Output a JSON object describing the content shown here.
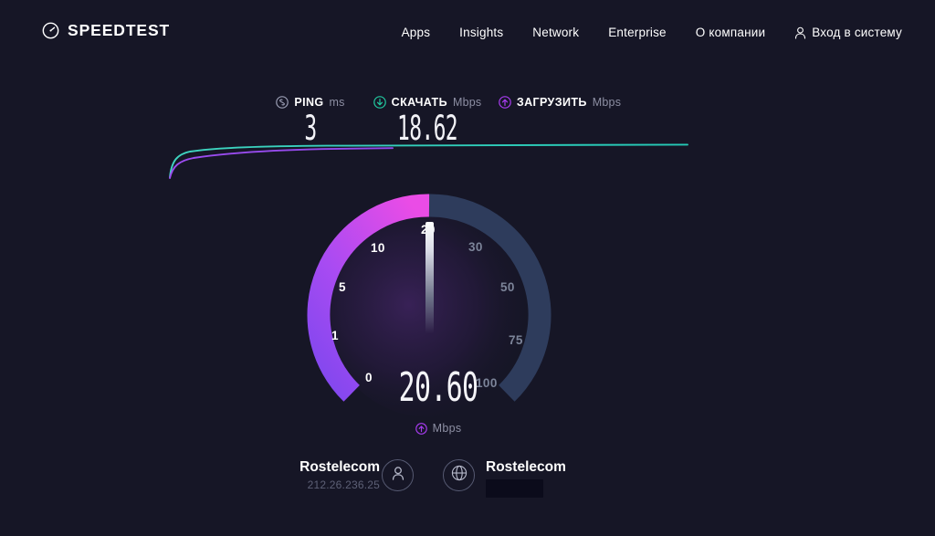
{
  "header": {
    "logo_text": "SPEEDTEST",
    "logo_icon": "speedometer-icon",
    "nav": [
      {
        "label": "Apps"
      },
      {
        "label": "Insights"
      },
      {
        "label": "Network"
      },
      {
        "label": "Enterprise"
      },
      {
        "label": "О компании"
      }
    ],
    "login": {
      "label": "Вход в систему",
      "icon": "person-icon"
    }
  },
  "metrics": {
    "ping": {
      "label": "PING",
      "unit": "ms",
      "value": "3",
      "icon": "ping-icon",
      "color": "#9a9db3"
    },
    "download": {
      "label": "СКАЧАТЬ",
      "unit": "Mbps",
      "value": "18.62",
      "icon": "download-icon",
      "color": "#22c9a0"
    },
    "upload": {
      "label": "ЗАГРУЗИТЬ",
      "unit": "Mbps",
      "value": "",
      "icon": "upload-icon",
      "color": "#a83cf0"
    }
  },
  "gauge": {
    "value": "20.60",
    "unit": "Mbps",
    "unit_icon": "upload-icon",
    "phase": "upload",
    "ticks": [
      {
        "label": "0",
        "active": true
      },
      {
        "label": "1",
        "active": true
      },
      {
        "label": "5",
        "active": true
      },
      {
        "label": "10",
        "active": true
      },
      {
        "label": "20",
        "active": true
      },
      {
        "label": "30",
        "active": false
      },
      {
        "label": "50",
        "active": false
      },
      {
        "label": "75",
        "active": false
      },
      {
        "label": "100",
        "active": false
      }
    ],
    "active_color_start": "#8a4ef0",
    "active_color_end": "#e84ce8",
    "track_color": "#2e3c5c",
    "needle_position_label": "20"
  },
  "chart_data": {
    "type": "line",
    "title": "",
    "xlabel": "",
    "ylabel": "",
    "series": [
      {
        "name": "download",
        "color": "#3fd4c0",
        "x": [
          0,
          2,
          5,
          9,
          14,
          22,
          35,
          55,
          80,
          120,
          170,
          230,
          320,
          430,
          560,
          572
        ],
        "y": [
          38,
          22,
          14,
          10,
          8,
          6.5,
          5.5,
          5,
          4.6,
          4.3,
          4.1,
          4.0,
          3.9,
          3.8,
          3.7,
          3.6
        ]
      },
      {
        "name": "upload",
        "color": "#a44cf0",
        "x": [
          0,
          3,
          7,
          12,
          18,
          28,
          42,
          62,
          90,
          125,
          160,
          200,
          240,
          250
        ],
        "y": [
          40,
          32,
          25,
          20,
          17,
          14,
          12,
          11,
          10.2,
          9.6,
          9.2,
          9.0,
          8.9,
          8.8
        ]
      }
    ],
    "legend": "none",
    "grid": false
  },
  "footer": {
    "client": {
      "name": "Rostelecom",
      "ip": "212.26.236.25",
      "icon": "person-icon"
    },
    "server": {
      "name": "Rostelecom",
      "location": "",
      "location_redacted": true,
      "icon": "globe-icon"
    }
  }
}
